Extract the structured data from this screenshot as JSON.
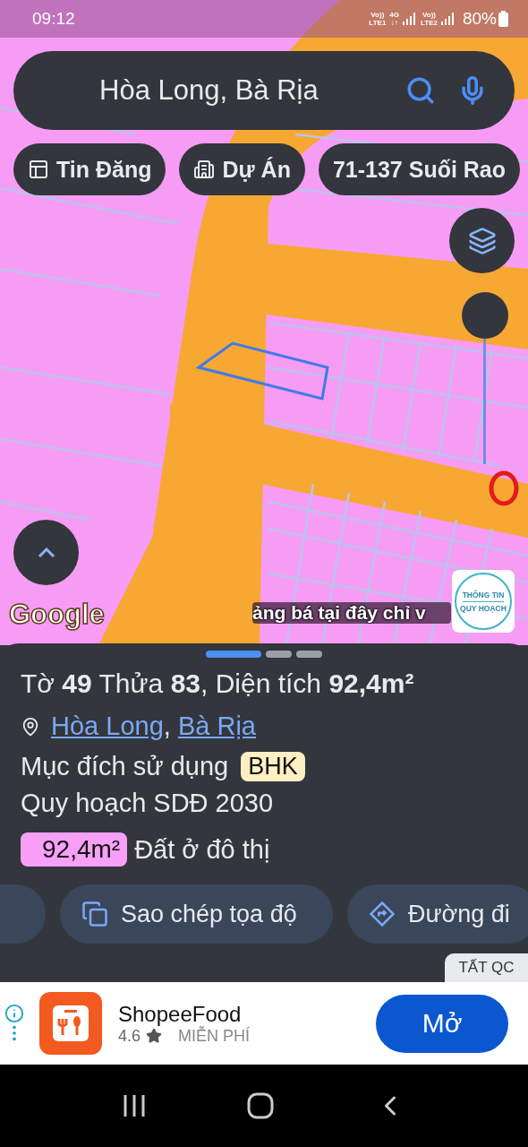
{
  "status_bar": {
    "time": "09:12",
    "indicators": [
      {
        "top": "Vo))",
        "bottom": "LTE1",
        "signal": false
      },
      {
        "top": "4G",
        "bottom": "↓↑",
        "signal": true
      },
      {
        "top": "Vo))",
        "bottom": "LTE2",
        "signal": true
      }
    ],
    "battery": "80%"
  },
  "search": {
    "value": "Hòa Long, Bà Rịa"
  },
  "chips": [
    {
      "label": "Tin Đăng",
      "kind": "listings"
    },
    {
      "label": "Dự Án",
      "kind": "projects"
    },
    {
      "label": "71-137 Suối Rao",
      "kind": "plain"
    }
  ],
  "map": {
    "logo": "Google",
    "marquee": "ảng bá tại đây chỉ v",
    "badge": [
      "THÔNG TIN",
      "QUY HOẠCH"
    ]
  },
  "pager": [
    {
      "selected": true
    },
    {
      "selected": false
    },
    {
      "selected": false
    }
  ],
  "sheet": {
    "title": "Tờ **49** Thửa **83**, Diện tích **92,4m²**",
    "location": [
      "Hòa Long",
      "Bà Rịa"
    ],
    "separator": ",",
    "purpose_label": "Mục đích sử dụng",
    "purpose_tag": "BHK",
    "plan": "Quy hoạch SDĐ 2030",
    "zones": [
      {
        "area": "92,4m²",
        "label": "Đất ở đô thị",
        "color": "#f8a0f8"
      }
    ],
    "actions": [
      {
        "kind": "edge"
      },
      {
        "kind": "copy",
        "label": "Sao chép tọa độ"
      },
      {
        "kind": "directions",
        "label": "Đường đi"
      }
    ]
  },
  "ad": {
    "close": "TẤT QC",
    "app": "ShopeeFood",
    "rating": "4.6",
    "price": "MIỄN PHÍ",
    "button": "Mở"
  }
}
